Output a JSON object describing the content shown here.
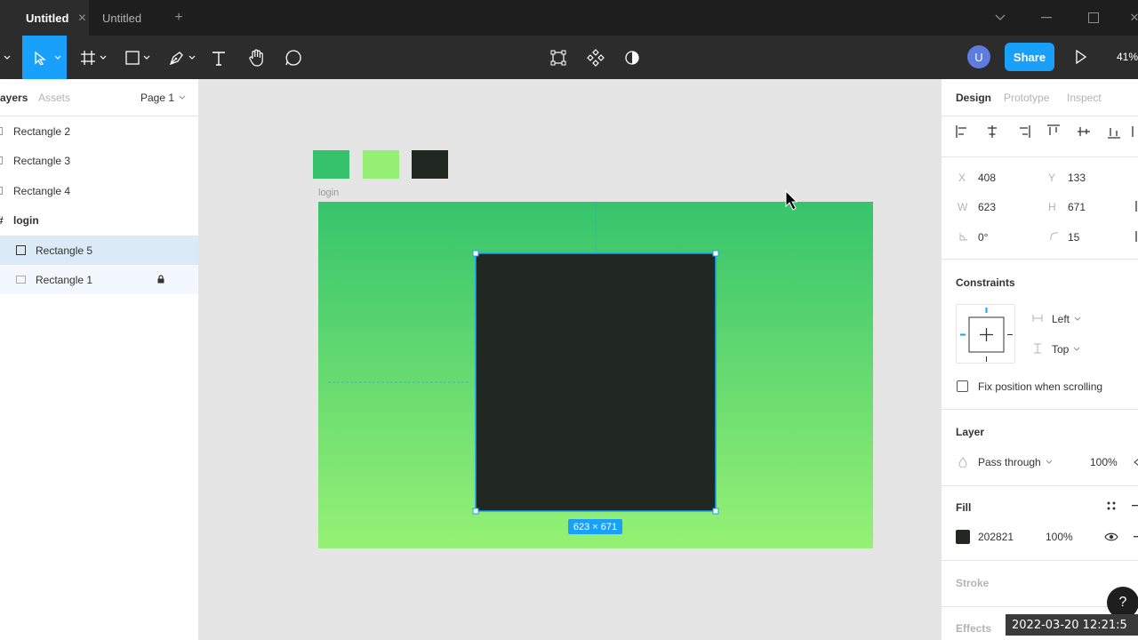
{
  "tabs": [
    {
      "label": "Untitled",
      "active": true
    },
    {
      "label": "Untitled",
      "active": false
    }
  ],
  "toolbar": {
    "share_label": "Share",
    "avatar_initial": "U",
    "zoom": "41%"
  },
  "left_panel": {
    "tab_layers": "ayers",
    "tab_assets": "Assets",
    "page": "Page 1",
    "layers": [
      {
        "label": "Rectangle 2"
      },
      {
        "label": "Rectangle 3"
      },
      {
        "label": "Rectangle 4"
      },
      {
        "label": "login"
      },
      {
        "label": "Rectangle 5"
      },
      {
        "label": "Rectangle 1"
      }
    ]
  },
  "canvas": {
    "frame_label": "login",
    "size_badge": "623 × 671",
    "swatches": [
      "#35c26b",
      "#95ef75",
      "#202821"
    ],
    "gradient_top": "#36c46c",
    "gradient_bottom": "#96f175",
    "rect_fill": "#202821",
    "selection_color": "#18a0fb"
  },
  "right_panel": {
    "tabs": {
      "design": "Design",
      "prototype": "Prototype",
      "inspect": "Inspect"
    },
    "x_label": "X",
    "x": "408",
    "y_label": "Y",
    "y": "133",
    "w_label": "W",
    "w": "623",
    "h_label": "H",
    "h": "671",
    "rotation": "0°",
    "radius": "15",
    "constraints_title": "Constraints",
    "constraint_h": "Left",
    "constraint_v": "Top",
    "fix_position": "Fix position when scrolling",
    "layer_title": "Layer",
    "blend_mode": "Pass through",
    "layer_opacity": "100%",
    "fill_title": "Fill",
    "fill_hex": "202821",
    "fill_opacity": "100%",
    "stroke_title": "Stroke",
    "effects_title": "Effects"
  },
  "timestamp": "2022-03-20  12:21:5",
  "help": "?"
}
